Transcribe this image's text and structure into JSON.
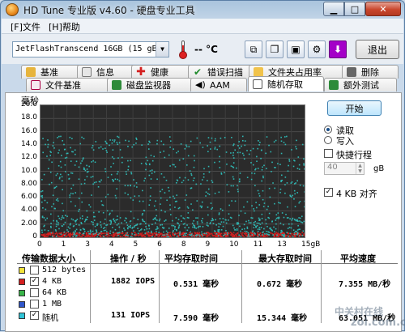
{
  "window": {
    "title": "HD Tune 专业版 v4.60 - 硬盘专业工具"
  },
  "menu": {
    "file": "[F]文件",
    "help": "[H]帮助"
  },
  "toolbar": {
    "drive": "JetFlashTranscend 16GB   (15 gB)",
    "temperature": "-- °C",
    "exit_label": "退出",
    "icons": [
      "copy-info-icon",
      "copy-screen-icon",
      "save-icon",
      "settings-icon",
      "download-icon"
    ]
  },
  "tabs": {
    "row1": [
      "基准",
      "信息",
      "健康",
      "错误扫描",
      "文件夹占用率",
      "删除"
    ],
    "row2": [
      "文件基准",
      "磁盘监视器",
      "AAM",
      "随机存取",
      "额外测试"
    ],
    "active": "随机存取"
  },
  "chart_data": {
    "type": "scatter",
    "ylabel": "毫秒",
    "yticks": [
      "20.0",
      "18.0",
      "16.0",
      "14.0",
      "12.0",
      "10.0",
      "8.00",
      "6.00",
      "4.00",
      "2.00",
      "0"
    ],
    "xticks": [
      "0",
      "1",
      "3",
      "4",
      "5",
      "6",
      "8",
      "9",
      "10",
      "11",
      "13",
      "15gB"
    ],
    "ylim": [
      0,
      20
    ],
    "xlim": [
      0,
      15
    ],
    "grid": true,
    "series": [
      {
        "name": "4 KB",
        "color": "#d42020",
        "ymin": 0.0,
        "ymax": 0.7,
        "mean": 0.531
      },
      {
        "name": "随机",
        "color": "#2fb7b3",
        "ymin": 0.0,
        "ymax": 15.3,
        "mean": 7.59
      }
    ]
  },
  "controls": {
    "start_label": "开始",
    "read_label": "读取",
    "write_label": "写入",
    "read_selected": true,
    "quick_stroke_label": "快捷行程",
    "quick_stroke_checked": false,
    "quick_stroke_value": "40",
    "quick_stroke_unit": "gB",
    "align_label": "4 KB 对齐",
    "align_checked": true
  },
  "results": {
    "headers": [
      "传输数据大小",
      "操作 / 秒",
      "平均存取时间",
      "最大存取时间",
      "平均速度"
    ],
    "rows": [
      {
        "label": "512 bytes",
        "color": "#f2e33a",
        "checked": false,
        "ops": "",
        "avg": "",
        "max": "",
        "speed": ""
      },
      {
        "label": "4 KB",
        "color": "#d42020",
        "checked": true,
        "ops": "1882 IOPS",
        "avg": "0.531 毫秒",
        "max": "0.672 毫秒",
        "speed": "7.355 MB/秒"
      },
      {
        "label": "64 KB",
        "color": "#39b54a",
        "checked": false,
        "ops": "",
        "avg": "",
        "max": "",
        "speed": ""
      },
      {
        "label": "1 MB",
        "color": "#2f56c9",
        "checked": false,
        "ops": "",
        "avg": "",
        "max": "",
        "speed": ""
      },
      {
        "label": "随机",
        "color": "#2fc3d6",
        "checked": true,
        "ops": "131 IOPS",
        "avg": "7.590 毫秒",
        "max": "15.344 毫秒",
        "speed": "63.051 MB/秒"
      }
    ]
  },
  "watermark": {
    "line1": "中关村在线",
    "line2": "zol.com.cn"
  }
}
